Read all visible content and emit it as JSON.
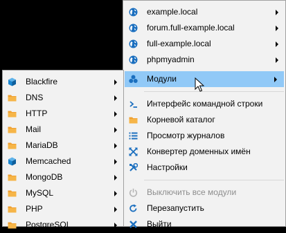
{
  "main_menu": {
    "sites": [
      {
        "label": "example.local",
        "icon": "globe-icon"
      },
      {
        "label": "forum.full-example.local",
        "icon": "globe-icon"
      },
      {
        "label": "full-example.local",
        "icon": "globe-icon"
      },
      {
        "label": "phpmyadmin",
        "icon": "globe-icon"
      }
    ],
    "modules_label": "Модули",
    "actions": [
      {
        "label": "Интерфейс командной строки",
        "icon": "terminal-icon"
      },
      {
        "label": "Корневой каталог",
        "icon": "folder-icon"
      },
      {
        "label": "Просмотр журналов",
        "icon": "log-list-icon"
      },
      {
        "label": "Конвертер доменных имён",
        "icon": "convert-arrows-icon"
      },
      {
        "label": "Настройки",
        "icon": "settings-tools-icon"
      }
    ],
    "disable_all_label": "Выключить все модули",
    "restart_label": "Перезапустить",
    "exit_label": "Выйти"
  },
  "sub_menu": {
    "items": [
      {
        "label": "Blackfire",
        "icon": "cube-icon"
      },
      {
        "label": "DNS",
        "icon": "folder-icon"
      },
      {
        "label": "HTTP",
        "icon": "folder-icon"
      },
      {
        "label": "Mail",
        "icon": "folder-icon"
      },
      {
        "label": "MariaDB",
        "icon": "folder-icon"
      },
      {
        "label": "Memcached",
        "icon": "cube-icon"
      },
      {
        "label": "MongoDB",
        "icon": "folder-icon"
      },
      {
        "label": "MySQL",
        "icon": "folder-icon"
      },
      {
        "label": "PHP",
        "icon": "folder-icon"
      },
      {
        "label": "PostgreSQL",
        "icon": "folder-icon"
      }
    ]
  },
  "colors": {
    "highlight": "#91c9f7",
    "globe": "#1b6fbf",
    "folder": "#f0a030",
    "cube": "#1a86d0",
    "disabled_text": "#8d8d8d"
  }
}
